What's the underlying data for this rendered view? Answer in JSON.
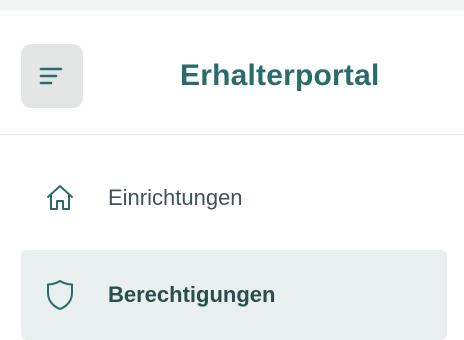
{
  "header": {
    "app_title": "Erhalterportal",
    "menu_icon": "menu-icon"
  },
  "nav": {
    "items": [
      {
        "label": "Einrichtungen",
        "icon": "home-icon",
        "active": false
      },
      {
        "label": "Berechtigungen",
        "icon": "shield-icon",
        "active": true
      }
    ]
  },
  "colors": {
    "brand": "#2a6c6c",
    "active_item_bg": "#e9eeee",
    "menu_button_bg": "#e4e6e6"
  }
}
